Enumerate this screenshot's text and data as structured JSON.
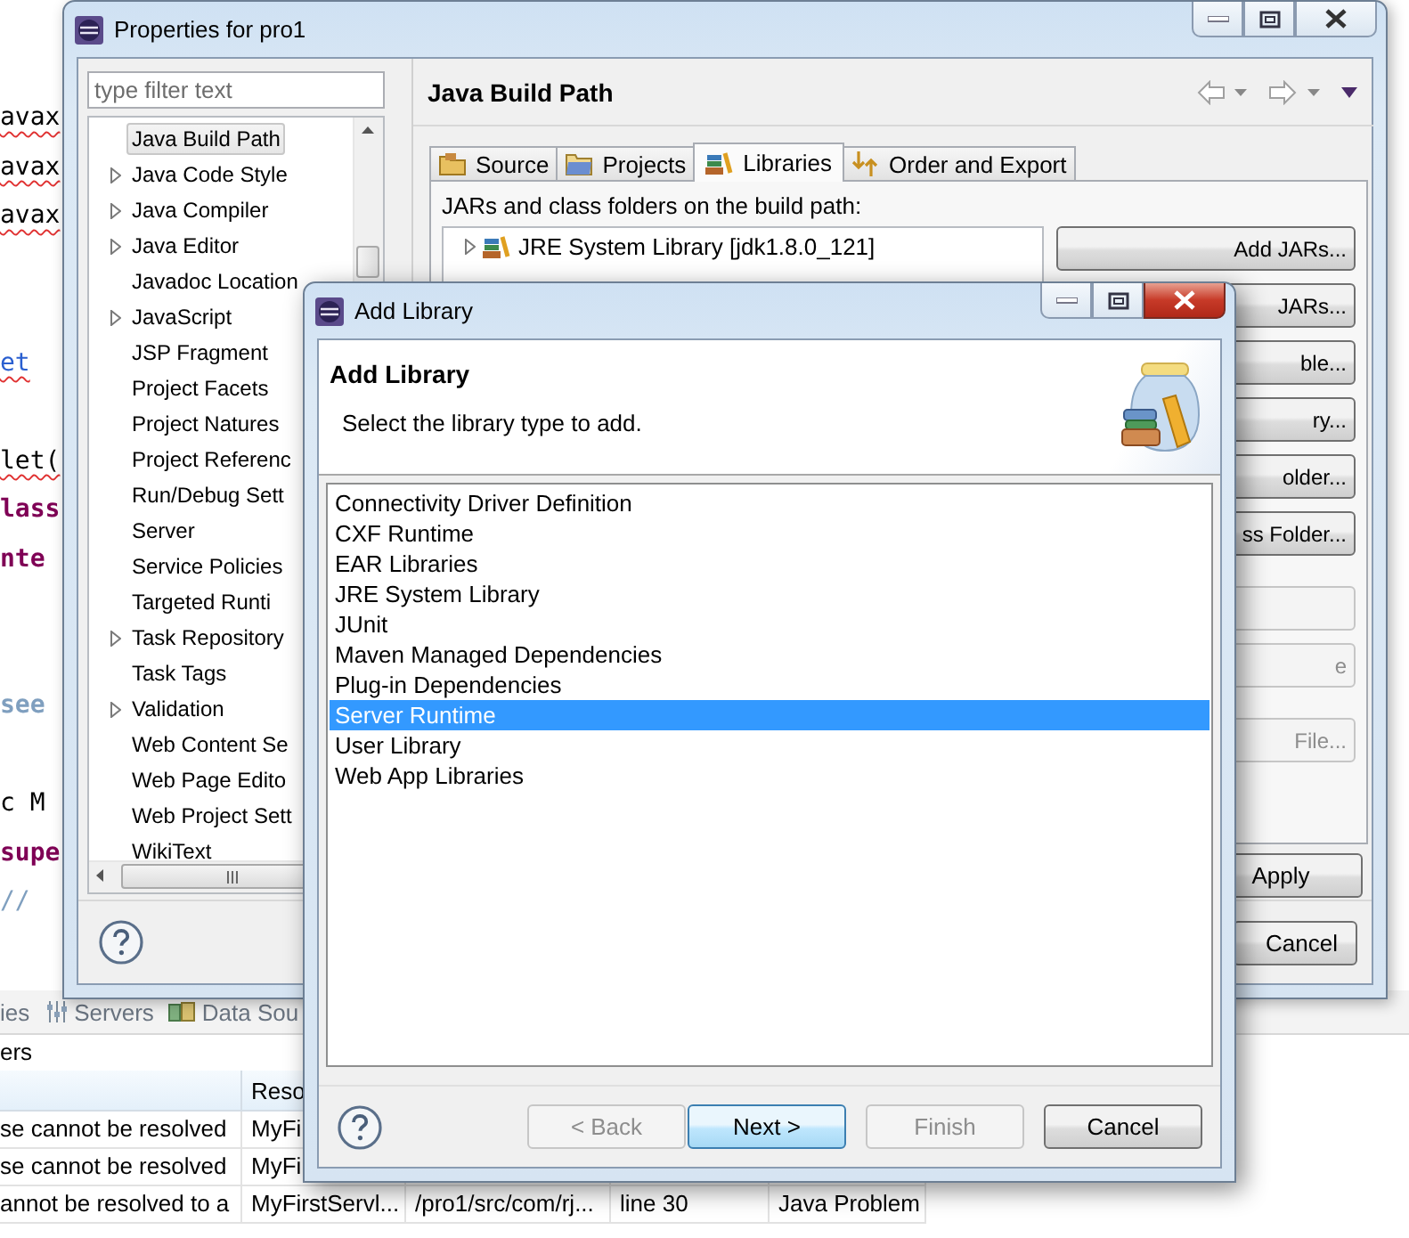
{
  "editor": {
    "code_blocks": [
      [
        {
          "text": "avax",
          "kind": "plain",
          "error": true
        },
        {
          "text": "avax",
          "kind": "plain",
          "error": true
        },
        {
          "text": "avax",
          "kind": "plain",
          "error": true
        }
      ],
      [
        {
          "text": "et",
          "kind": "field",
          "error": true
        }
      ],
      [
        {
          "text": "let(",
          "kind": "plain",
          "error": true
        },
        {
          "text": "lass",
          "kind": "keyword",
          "error": false
        },
        {
          "text": "nte",
          "kind": "keyword",
          "error": false
        }
      ],
      [
        {
          "text": "see",
          "kind": "doc",
          "error": false
        }
      ],
      [
        {
          "text": "c M",
          "kind": "plain",
          "error": false
        },
        {
          "text": "supe",
          "kind": "keyword",
          "error": false
        },
        {
          "text": "//",
          "kind": "comment",
          "error": false
        }
      ]
    ]
  },
  "bottom_panel": {
    "tabs": [
      {
        "label": "ies"
      },
      {
        "label": "Servers"
      },
      {
        "label": "Data Sou"
      }
    ],
    "heading": "ers",
    "header": {
      "column_2": "Reso"
    },
    "rows": [
      {
        "cells": [
          "se cannot be resolved",
          "MyFi"
        ]
      },
      {
        "cells": [
          "se cannot be resolved",
          "MyFi"
        ]
      },
      {
        "cells": [
          "annot be resolved to a",
          "MyFirstServl...",
          "/pro1/src/com/rj...",
          "line 30",
          "Java Problem"
        ]
      }
    ]
  },
  "properties": {
    "title": "Properties for pro1",
    "filter": {
      "placeholder": "type filter text"
    },
    "tree": [
      {
        "label": "Java Build Path",
        "selected": true
      },
      {
        "label": "Java Code Style",
        "selected": false,
        "expanded": false
      },
      {
        "label": "Java Compiler",
        "selected": false,
        "expanded": false
      },
      {
        "label": "Java Editor",
        "selected": false,
        "expanded": false
      },
      {
        "label": "Javadoc Location",
        "selected": false
      },
      {
        "label": "JavaScript",
        "selected": false,
        "expanded": false
      },
      {
        "label": "JSP Fragment",
        "selected": false
      },
      {
        "label": "Project Facets",
        "selected": false
      },
      {
        "label": "Project Natures",
        "selected": false
      },
      {
        "label": "Project Referenc",
        "selected": false
      },
      {
        "label": "Run/Debug Sett",
        "selected": false
      },
      {
        "label": "Server",
        "selected": false
      },
      {
        "label": "Service Policies",
        "selected": false
      },
      {
        "label": "Targeted Runti",
        "selected": false
      },
      {
        "label": "Task Repository",
        "selected": false,
        "expanded": false
      },
      {
        "label": "Task Tags",
        "selected": false
      },
      {
        "label": "Validation",
        "selected": false,
        "expanded": false
      },
      {
        "label": "Web Content Se",
        "selected": false
      },
      {
        "label": "Web Page Edito",
        "selected": false
      },
      {
        "label": "Web Project Sett",
        "selected": false
      },
      {
        "label": "WikiText",
        "selected": false
      }
    ],
    "page_title": "Java Build Path",
    "tabs": [
      {
        "label": "Source",
        "selected": false
      },
      {
        "label": "Projects",
        "selected": false
      },
      {
        "label": "Libraries",
        "selected": true
      },
      {
        "label": "Order and Export",
        "selected": false
      }
    ],
    "build_path_label": "JARs and class folders on the build path:",
    "entries": [
      {
        "label": "JRE System Library [jdk1.8.0_121]",
        "expanded": false
      }
    ],
    "side_buttons": [
      {
        "label": "Add JARs...",
        "disabled": false
      },
      {
        "label": "JARs...",
        "disabled": false
      },
      {
        "label": "ble...",
        "disabled": false
      },
      {
        "label": "ry...",
        "disabled": false
      },
      {
        "label": "older...",
        "disabled": false
      },
      {
        "label": "ss Folder...",
        "disabled": false
      },
      {
        "disabled": true
      },
      {
        "label": "e",
        "disabled": true
      },
      {
        "label": "File...",
        "disabled": true
      }
    ],
    "apply": "Apply",
    "cancel": "Cancel"
  },
  "dialog": {
    "title": "Add Library",
    "heading": "Add Library",
    "description": "Select the library type to add.",
    "library_types": [
      {
        "label": "Connectivity Driver Definition",
        "selected": false
      },
      {
        "label": "CXF Runtime",
        "selected": false
      },
      {
        "label": "EAR Libraries",
        "selected": false
      },
      {
        "label": "JRE System Library",
        "selected": false
      },
      {
        "label": "JUnit",
        "selected": false
      },
      {
        "label": "Maven Managed Dependencies",
        "selected": false
      },
      {
        "label": "Plug-in Dependencies",
        "selected": false
      },
      {
        "label": "Server Runtime",
        "selected": true
      },
      {
        "label": "User Library",
        "selected": false
      },
      {
        "label": "Web App Libraries",
        "selected": false
      }
    ],
    "buttons": [
      {
        "label": "< Back",
        "disabled": true,
        "default": false
      },
      {
        "label": "Next >",
        "disabled": false,
        "default": true
      },
      {
        "label": "Finish",
        "disabled": true,
        "default": false
      },
      {
        "label": "Cancel",
        "disabled": false,
        "default": false
      }
    ]
  }
}
